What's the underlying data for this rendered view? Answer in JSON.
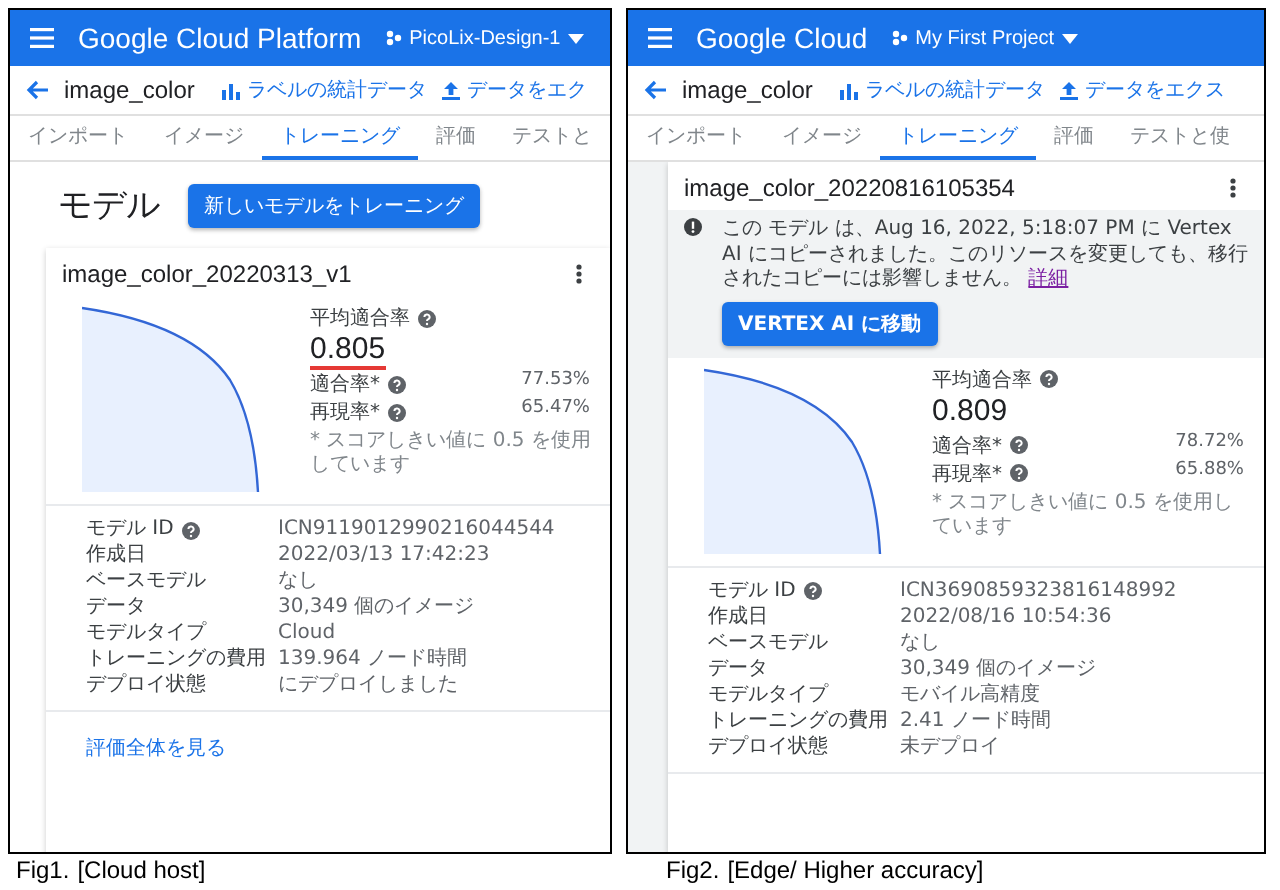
{
  "figures": [
    {
      "app": {
        "brand": "Google Cloud Platform",
        "project": "PicoLix-Design-1"
      },
      "toolbar": {
        "title": "image_color",
        "actions": [
          {
            "kind": "stats",
            "label": "ラベルの統計データ"
          },
          {
            "kind": "export",
            "label": "データをエク"
          }
        ]
      },
      "tabs": [
        {
          "label": "インポート",
          "selected": false
        },
        {
          "label": "イメージ",
          "selected": false
        },
        {
          "label": "トレーニング",
          "selected": true
        },
        {
          "label": "評価",
          "selected": false
        },
        {
          "label": "テストと",
          "selected": false
        }
      ],
      "section": {
        "heading": "モデル",
        "button": "新しいモデルをトレーニング"
      },
      "model": {
        "name": "image_color_20220313_v1",
        "metrics": {
          "label": "平均適合率",
          "value": "0.805",
          "underlined": true,
          "rows": [
            {
              "label": "適合率*",
              "value": "77.53%"
            },
            {
              "label": "再現率*",
              "value": "65.47%"
            }
          ],
          "note": "* スコアしきい値に 0.5 を使用しています"
        },
        "details": [
          {
            "label": "モデル ID",
            "help": true,
            "value": "ICN9119012990216044544"
          },
          {
            "label": "作成日",
            "help": false,
            "value": "2022/03/13 17:42:23"
          },
          {
            "label": "ベースモデル",
            "help": false,
            "value": "なし"
          },
          {
            "label": "データ",
            "help": false,
            "value": "30,349 個のイメージ"
          },
          {
            "label": "モデルタイプ",
            "help": false,
            "value": "Cloud"
          },
          {
            "label": "トレーニングの費用",
            "help": false,
            "value": "139.964 ノード時間"
          },
          {
            "label": "デプロイ状態",
            "help": false,
            "value": "にデプロイしました"
          }
        ],
        "link": "評価全体を見る"
      },
      "caption": {
        "label": "Fig1.",
        "text": "[Cloud host]"
      }
    },
    {
      "app": {
        "brand": "Google Cloud",
        "project": "My First Project"
      },
      "toolbar": {
        "title": "image_color",
        "actions": [
          {
            "kind": "stats",
            "label": "ラベルの統計データ"
          },
          {
            "kind": "export",
            "label": "データをエクス"
          }
        ]
      },
      "tabs": [
        {
          "label": "インポート",
          "selected": false
        },
        {
          "label": "イメージ",
          "selected": false
        },
        {
          "label": "トレーニング",
          "selected": true
        },
        {
          "label": "評価",
          "selected": false
        },
        {
          "label": "テストと使",
          "selected": false
        }
      ],
      "model": {
        "name": "image_color_20220816105354",
        "notice": {
          "text": "この モデル は、Aug 16, 2022, 5:18:07 PM に Vertex AI にコピーされました。このリソースを変更しても、移行されたコピーには影響しません。",
          "link": "詳細",
          "button": "VERTEX AI に移動"
        },
        "metrics": {
          "label": "平均適合率",
          "value": "0.809",
          "underlined": false,
          "rows": [
            {
              "label": "適合率*",
              "value": "78.72%"
            },
            {
              "label": "再現率*",
              "value": "65.88%"
            }
          ],
          "note": "* スコアしきい値に 0.5 を使用しています"
        },
        "details": [
          {
            "label": "モデル ID",
            "help": true,
            "value": "ICN3690859323816148992"
          },
          {
            "label": "作成日",
            "help": false,
            "value": "2022/08/16 10:54:36"
          },
          {
            "label": "ベースモデル",
            "help": false,
            "value": "なし"
          },
          {
            "label": "データ",
            "help": false,
            "value": "30,349 個のイメージ"
          },
          {
            "label": "モデルタイプ",
            "help": false,
            "value": "モバイル高精度"
          },
          {
            "label": "トレーニングの費用",
            "help": false,
            "value": "2.41 ノード時間"
          },
          {
            "label": "デプロイ状態",
            "help": false,
            "value": "未デプロイ"
          }
        ]
      },
      "caption": {
        "label": "Fig2.",
        "text": "[Edge/ Higher accuracy]"
      }
    }
  ]
}
